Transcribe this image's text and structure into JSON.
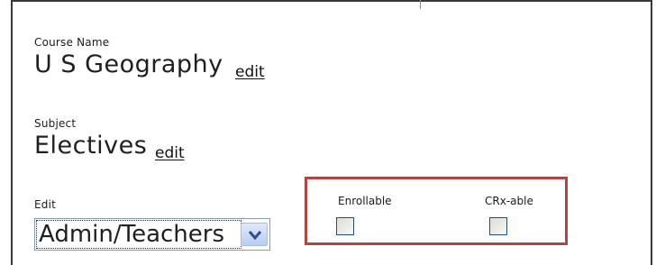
{
  "course": {
    "name_label": "Course Name",
    "name_value": "U S Geography",
    "name_edit": "edit"
  },
  "subject": {
    "label": "Subject",
    "value": "Electives",
    "edit": "edit"
  },
  "edit_field": {
    "label": "Edit",
    "selected": "Admin/Teachers"
  },
  "options": {
    "enrollable_label": "Enrollable",
    "enrollable_checked": false,
    "crxable_label": "CRx-able",
    "crxable_checked": false
  },
  "colors": {
    "highlight_border": "#b5443f",
    "checkbox_border": "#1c5180",
    "select_button": "#b9cdf2"
  },
  "icons": {
    "dropdown": "chevron-down-icon"
  }
}
